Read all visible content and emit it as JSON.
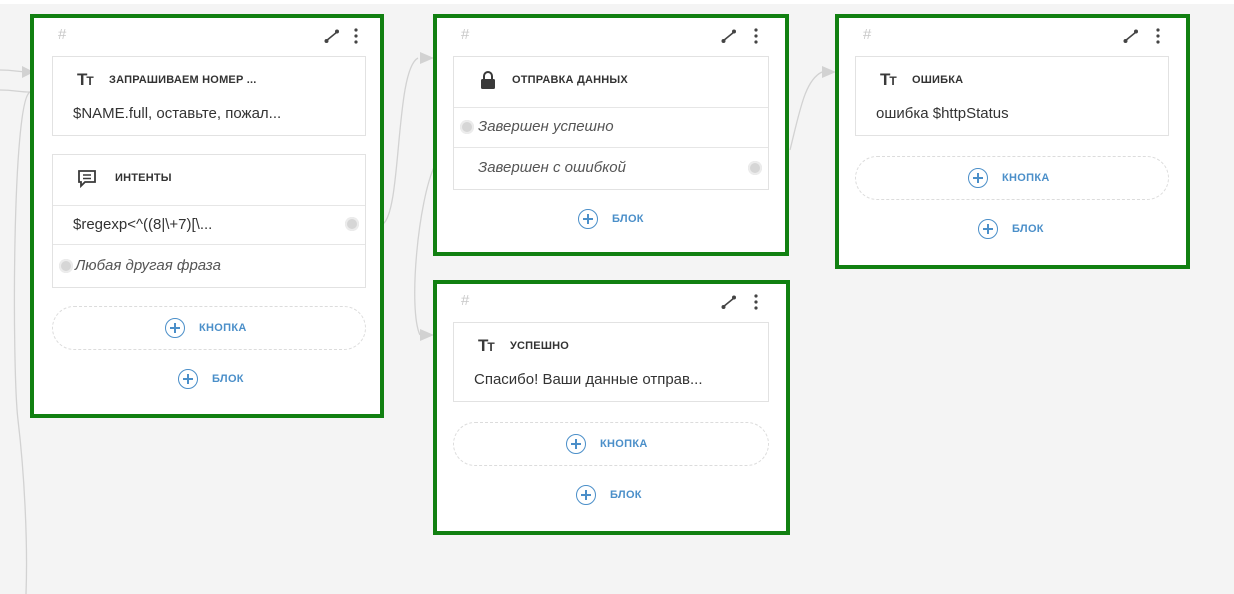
{
  "nodes": {
    "request_number": {
      "hash": "#",
      "message_card": {
        "title": "ЗАПРАШИВАЕМ НОМЕР ...",
        "text": "$NAME.full, оставьте, пожал..."
      },
      "intents_card": {
        "title": "ИНТЕНТЫ",
        "rows": [
          "$regexp<^((8|\\+7)[\\...",
          "Любая другая фраза"
        ]
      },
      "button_label": "КНОПКА",
      "block_label": "БЛОК"
    },
    "send_data": {
      "hash": "#",
      "card": {
        "title": "ОТПРАВКА ДАННЫХ",
        "rows": [
          "Завершен успешно",
          "Завершен с ошибкой"
        ]
      },
      "block_label": "БЛОК"
    },
    "error": {
      "hash": "#",
      "card": {
        "title": "ОШИБКА",
        "text": "ошибка $httpStatus"
      },
      "button_label": "КНОПКА",
      "block_label": "БЛОК"
    },
    "success": {
      "hash": "#",
      "card": {
        "title": "УСПЕШНО",
        "text": "Спасибо! Ваши данные отправ..."
      },
      "button_label": "КНОПКА",
      "block_label": "БЛОК"
    }
  },
  "icons": {
    "text": "text-format-icon",
    "intents": "chat-bubble-icon",
    "lock": "lock-icon",
    "edit": "connect-line-icon",
    "more": "more-vertical-icon",
    "add": "plus-circle-icon"
  },
  "colors": {
    "node_border": "#118011",
    "accent": "#4b8fc9",
    "background": "#f4f4f4"
  }
}
